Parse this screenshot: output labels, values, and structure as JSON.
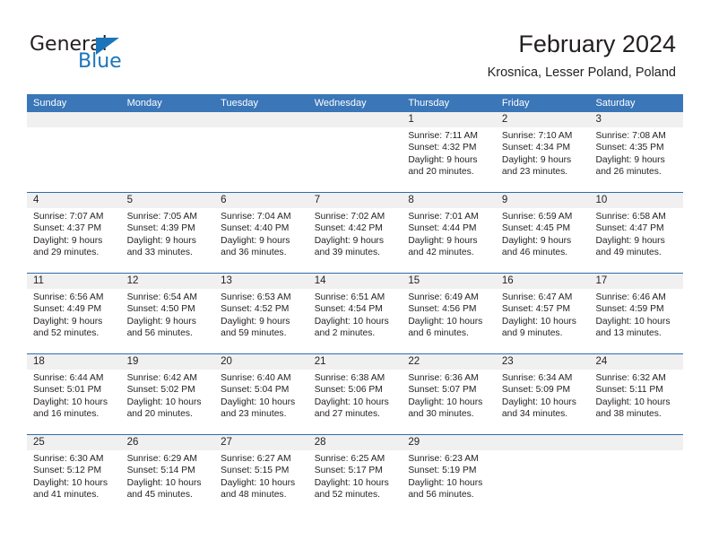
{
  "logo": {
    "word_one": "General",
    "word_two": "Blue",
    "icon": "triangle-logo-mark"
  },
  "header": {
    "title": "February 2024",
    "location": "Krosnica, Lesser Poland, Poland"
  },
  "colors": {
    "header_band": "#3a76b8",
    "week_separator": "#2e6ead",
    "day_number_band": "#f0f0f0",
    "logo_blue": "#1b75bb",
    "text": "#231f20"
  },
  "weekdays": [
    "Sunday",
    "Monday",
    "Tuesday",
    "Wednesday",
    "Thursday",
    "Friday",
    "Saturday"
  ],
  "weeks": [
    [
      {
        "day": "",
        "sunrise": "",
        "sunset": "",
        "daylight_line1": "",
        "daylight_line2": ""
      },
      {
        "day": "",
        "sunrise": "",
        "sunset": "",
        "daylight_line1": "",
        "daylight_line2": ""
      },
      {
        "day": "",
        "sunrise": "",
        "sunset": "",
        "daylight_line1": "",
        "daylight_line2": ""
      },
      {
        "day": "",
        "sunrise": "",
        "sunset": "",
        "daylight_line1": "",
        "daylight_line2": ""
      },
      {
        "day": "1",
        "sunrise": "Sunrise: 7:11 AM",
        "sunset": "Sunset: 4:32 PM",
        "daylight_line1": "Daylight: 9 hours",
        "daylight_line2": "and 20 minutes."
      },
      {
        "day": "2",
        "sunrise": "Sunrise: 7:10 AM",
        "sunset": "Sunset: 4:34 PM",
        "daylight_line1": "Daylight: 9 hours",
        "daylight_line2": "and 23 minutes."
      },
      {
        "day": "3",
        "sunrise": "Sunrise: 7:08 AM",
        "sunset": "Sunset: 4:35 PM",
        "daylight_line1": "Daylight: 9 hours",
        "daylight_line2": "and 26 minutes."
      }
    ],
    [
      {
        "day": "4",
        "sunrise": "Sunrise: 7:07 AM",
        "sunset": "Sunset: 4:37 PM",
        "daylight_line1": "Daylight: 9 hours",
        "daylight_line2": "and 29 minutes."
      },
      {
        "day": "5",
        "sunrise": "Sunrise: 7:05 AM",
        "sunset": "Sunset: 4:39 PM",
        "daylight_line1": "Daylight: 9 hours",
        "daylight_line2": "and 33 minutes."
      },
      {
        "day": "6",
        "sunrise": "Sunrise: 7:04 AM",
        "sunset": "Sunset: 4:40 PM",
        "daylight_line1": "Daylight: 9 hours",
        "daylight_line2": "and 36 minutes."
      },
      {
        "day": "7",
        "sunrise": "Sunrise: 7:02 AM",
        "sunset": "Sunset: 4:42 PM",
        "daylight_line1": "Daylight: 9 hours",
        "daylight_line2": "and 39 minutes."
      },
      {
        "day": "8",
        "sunrise": "Sunrise: 7:01 AM",
        "sunset": "Sunset: 4:44 PM",
        "daylight_line1": "Daylight: 9 hours",
        "daylight_line2": "and 42 minutes."
      },
      {
        "day": "9",
        "sunrise": "Sunrise: 6:59 AM",
        "sunset": "Sunset: 4:45 PM",
        "daylight_line1": "Daylight: 9 hours",
        "daylight_line2": "and 46 minutes."
      },
      {
        "day": "10",
        "sunrise": "Sunrise: 6:58 AM",
        "sunset": "Sunset: 4:47 PM",
        "daylight_line1": "Daylight: 9 hours",
        "daylight_line2": "and 49 minutes."
      }
    ],
    [
      {
        "day": "11",
        "sunrise": "Sunrise: 6:56 AM",
        "sunset": "Sunset: 4:49 PM",
        "daylight_line1": "Daylight: 9 hours",
        "daylight_line2": "and 52 minutes."
      },
      {
        "day": "12",
        "sunrise": "Sunrise: 6:54 AM",
        "sunset": "Sunset: 4:50 PM",
        "daylight_line1": "Daylight: 9 hours",
        "daylight_line2": "and 56 minutes."
      },
      {
        "day": "13",
        "sunrise": "Sunrise: 6:53 AM",
        "sunset": "Sunset: 4:52 PM",
        "daylight_line1": "Daylight: 9 hours",
        "daylight_line2": "and 59 minutes."
      },
      {
        "day": "14",
        "sunrise": "Sunrise: 6:51 AM",
        "sunset": "Sunset: 4:54 PM",
        "daylight_line1": "Daylight: 10 hours",
        "daylight_line2": "and 2 minutes."
      },
      {
        "day": "15",
        "sunrise": "Sunrise: 6:49 AM",
        "sunset": "Sunset: 4:56 PM",
        "daylight_line1": "Daylight: 10 hours",
        "daylight_line2": "and 6 minutes."
      },
      {
        "day": "16",
        "sunrise": "Sunrise: 6:47 AM",
        "sunset": "Sunset: 4:57 PM",
        "daylight_line1": "Daylight: 10 hours",
        "daylight_line2": "and 9 minutes."
      },
      {
        "day": "17",
        "sunrise": "Sunrise: 6:46 AM",
        "sunset": "Sunset: 4:59 PM",
        "daylight_line1": "Daylight: 10 hours",
        "daylight_line2": "and 13 minutes."
      }
    ],
    [
      {
        "day": "18",
        "sunrise": "Sunrise: 6:44 AM",
        "sunset": "Sunset: 5:01 PM",
        "daylight_line1": "Daylight: 10 hours",
        "daylight_line2": "and 16 minutes."
      },
      {
        "day": "19",
        "sunrise": "Sunrise: 6:42 AM",
        "sunset": "Sunset: 5:02 PM",
        "daylight_line1": "Daylight: 10 hours",
        "daylight_line2": "and 20 minutes."
      },
      {
        "day": "20",
        "sunrise": "Sunrise: 6:40 AM",
        "sunset": "Sunset: 5:04 PM",
        "daylight_line1": "Daylight: 10 hours",
        "daylight_line2": "and 23 minutes."
      },
      {
        "day": "21",
        "sunrise": "Sunrise: 6:38 AM",
        "sunset": "Sunset: 5:06 PM",
        "daylight_line1": "Daylight: 10 hours",
        "daylight_line2": "and 27 minutes."
      },
      {
        "day": "22",
        "sunrise": "Sunrise: 6:36 AM",
        "sunset": "Sunset: 5:07 PM",
        "daylight_line1": "Daylight: 10 hours",
        "daylight_line2": "and 30 minutes."
      },
      {
        "day": "23",
        "sunrise": "Sunrise: 6:34 AM",
        "sunset": "Sunset: 5:09 PM",
        "daylight_line1": "Daylight: 10 hours",
        "daylight_line2": "and 34 minutes."
      },
      {
        "day": "24",
        "sunrise": "Sunrise: 6:32 AM",
        "sunset": "Sunset: 5:11 PM",
        "daylight_line1": "Daylight: 10 hours",
        "daylight_line2": "and 38 minutes."
      }
    ],
    [
      {
        "day": "25",
        "sunrise": "Sunrise: 6:30 AM",
        "sunset": "Sunset: 5:12 PM",
        "daylight_line1": "Daylight: 10 hours",
        "daylight_line2": "and 41 minutes."
      },
      {
        "day": "26",
        "sunrise": "Sunrise: 6:29 AM",
        "sunset": "Sunset: 5:14 PM",
        "daylight_line1": "Daylight: 10 hours",
        "daylight_line2": "and 45 minutes."
      },
      {
        "day": "27",
        "sunrise": "Sunrise: 6:27 AM",
        "sunset": "Sunset: 5:15 PM",
        "daylight_line1": "Daylight: 10 hours",
        "daylight_line2": "and 48 minutes."
      },
      {
        "day": "28",
        "sunrise": "Sunrise: 6:25 AM",
        "sunset": "Sunset: 5:17 PM",
        "daylight_line1": "Daylight: 10 hours",
        "daylight_line2": "and 52 minutes."
      },
      {
        "day": "29",
        "sunrise": "Sunrise: 6:23 AM",
        "sunset": "Sunset: 5:19 PM",
        "daylight_line1": "Daylight: 10 hours",
        "daylight_line2": "and 56 minutes."
      },
      {
        "day": "",
        "sunrise": "",
        "sunset": "",
        "daylight_line1": "",
        "daylight_line2": ""
      },
      {
        "day": "",
        "sunrise": "",
        "sunset": "",
        "daylight_line1": "",
        "daylight_line2": ""
      }
    ]
  ]
}
